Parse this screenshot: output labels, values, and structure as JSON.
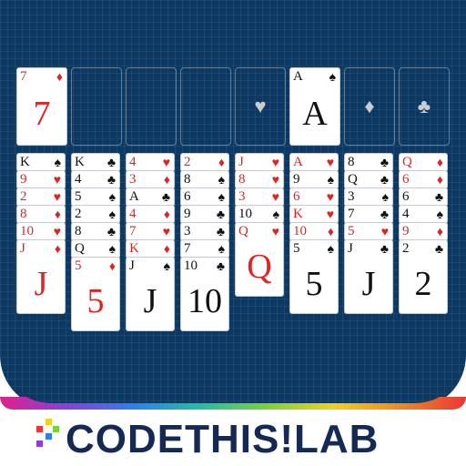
{
  "foundations": [
    {
      "rank": "7",
      "suit": "♦",
      "color": "red",
      "big": "7"
    },
    {
      "empty": true,
      "suit": ""
    },
    {
      "empty": true,
      "suit": ""
    },
    {
      "empty": true,
      "suit": ""
    },
    {
      "empty": true,
      "suit": "♥"
    },
    {
      "rank": "A",
      "suit": "♠",
      "color": "black",
      "big": "A"
    },
    {
      "empty": true,
      "suit": "♦"
    },
    {
      "empty": true,
      "suit": "♣"
    }
  ],
  "tableau": [
    {
      "cards": [
        {
          "r": "K",
          "s": "♠",
          "c": "black"
        },
        {
          "r": "9",
          "s": "♥",
          "c": "red"
        },
        {
          "r": "2",
          "s": "♥",
          "c": "red"
        },
        {
          "r": "8",
          "s": "♦",
          "c": "red"
        },
        {
          "r": "10",
          "s": "♥",
          "c": "red"
        },
        {
          "r": "J",
          "s": "♦",
          "c": "red"
        }
      ]
    },
    {
      "cards": [
        {
          "r": "K",
          "s": "♣",
          "c": "black"
        },
        {
          "r": "4",
          "s": "♣",
          "c": "black"
        },
        {
          "r": "5",
          "s": "♠",
          "c": "black"
        },
        {
          "r": "2",
          "s": "♠",
          "c": "black"
        },
        {
          "r": "8",
          "s": "♣",
          "c": "black"
        },
        {
          "r": "Q",
          "s": "♠",
          "c": "black"
        },
        {
          "r": "5",
          "s": "♦",
          "c": "red"
        }
      ]
    },
    {
      "cards": [
        {
          "r": "4",
          "s": "♥",
          "c": "red"
        },
        {
          "r": "3",
          "s": "♦",
          "c": "red"
        },
        {
          "r": "A",
          "s": "♣",
          "c": "black"
        },
        {
          "r": "4",
          "s": "♦",
          "c": "red"
        },
        {
          "r": "7",
          "s": "♥",
          "c": "red"
        },
        {
          "r": "K",
          "s": "♦",
          "c": "red"
        },
        {
          "r": "J",
          "s": "♠",
          "c": "black"
        }
      ]
    },
    {
      "cards": [
        {
          "r": "2",
          "s": "♦",
          "c": "red"
        },
        {
          "r": "8",
          "s": "♠",
          "c": "black"
        },
        {
          "r": "6",
          "s": "♠",
          "c": "black"
        },
        {
          "r": "9",
          "s": "♣",
          "c": "black"
        },
        {
          "r": "3",
          "s": "♣",
          "c": "black"
        },
        {
          "r": "7",
          "s": "♠",
          "c": "black"
        },
        {
          "r": "10",
          "s": "♣",
          "c": "black"
        }
      ]
    },
    {
      "cards": [
        {
          "r": "J",
          "s": "♥",
          "c": "red"
        },
        {
          "r": "8",
          "s": "♥",
          "c": "red"
        },
        {
          "r": "3",
          "s": "♥",
          "c": "red"
        },
        {
          "r": "10",
          "s": "♠",
          "c": "black"
        },
        {
          "r": "Q",
          "s": "♥",
          "c": "red"
        }
      ]
    },
    {
      "cards": [
        {
          "r": "A",
          "s": "♥",
          "c": "red"
        },
        {
          "r": "9",
          "s": "♠",
          "c": "black"
        },
        {
          "r": "6",
          "s": "♥",
          "c": "red"
        },
        {
          "r": "K",
          "s": "♥",
          "c": "red"
        },
        {
          "r": "10",
          "s": "♦",
          "c": "red"
        },
        {
          "r": "5",
          "s": "♠",
          "c": "black"
        }
      ]
    },
    {
      "cards": [
        {
          "r": "8",
          "s": "♣",
          "c": "black"
        },
        {
          "r": "Q",
          "s": "♣",
          "c": "black"
        },
        {
          "r": "3",
          "s": "♠",
          "c": "black"
        },
        {
          "r": "7",
          "s": "♣",
          "c": "black"
        },
        {
          "r": "5",
          "s": "♥",
          "c": "red"
        },
        {
          "r": "J",
          "s": "♣",
          "c": "black"
        }
      ]
    },
    {
      "cards": [
        {
          "r": "Q",
          "s": "♦",
          "c": "red"
        },
        {
          "r": "6",
          "s": "♦",
          "c": "red"
        },
        {
          "r": "6",
          "s": "♣",
          "c": "black"
        },
        {
          "r": "4",
          "s": "♠",
          "c": "black"
        },
        {
          "r": "9",
          "s": "♦",
          "c": "red"
        },
        {
          "r": "2",
          "s": "♣",
          "c": "black"
        }
      ]
    }
  ],
  "logo": {
    "text": "CODETHIS!LAB"
  }
}
